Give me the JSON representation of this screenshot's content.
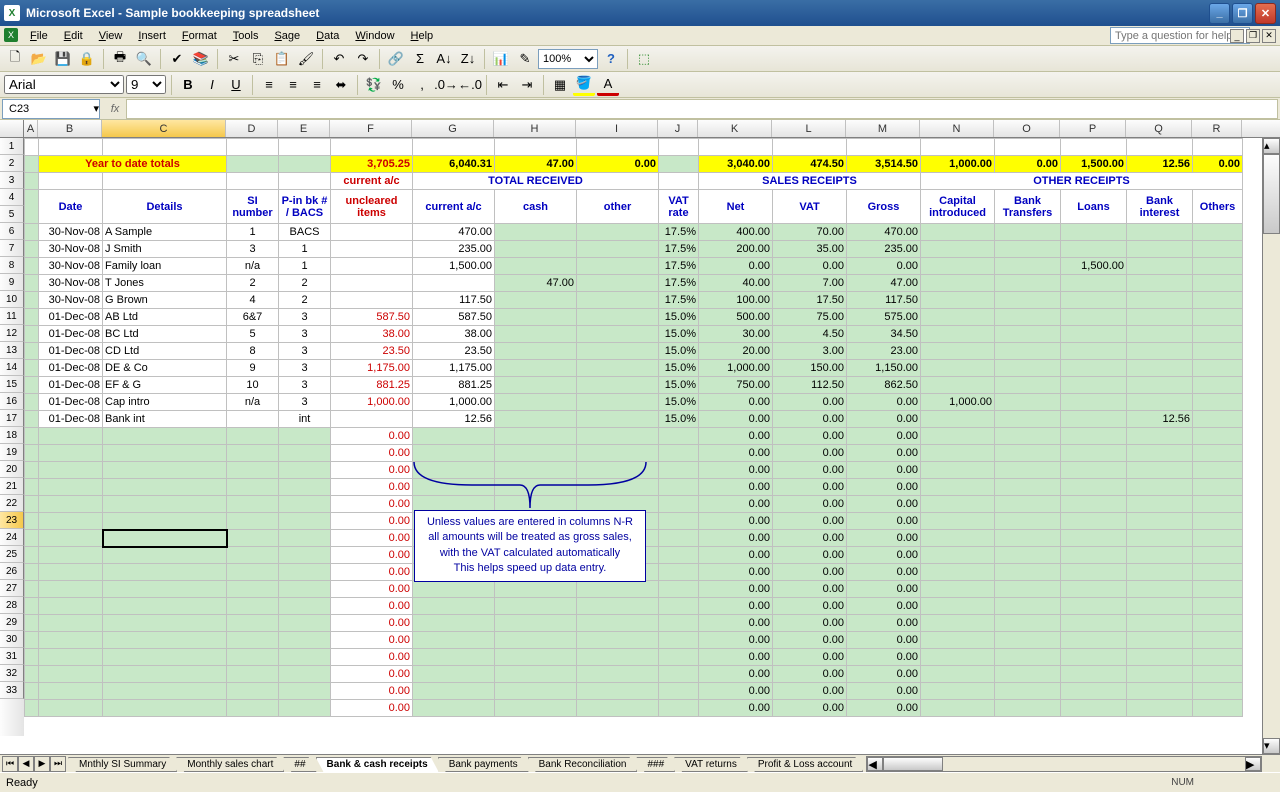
{
  "window": {
    "title": "Microsoft Excel - Sample bookkeeping spreadsheet"
  },
  "menus": [
    "File",
    "Edit",
    "View",
    "Insert",
    "Format",
    "Tools",
    "Sage",
    "Data",
    "Window",
    "Help"
  ],
  "helpPlaceholder": "Type a question for help",
  "nameBox": "C23",
  "font": {
    "name": "Arial",
    "size": "9"
  },
  "zoom": "100%",
  "columns": [
    {
      "l": "A",
      "w": 14
    },
    {
      "l": "B",
      "w": 64
    },
    {
      "l": "C",
      "w": 124
    },
    {
      "l": "D",
      "w": 52
    },
    {
      "l": "E",
      "w": 52
    },
    {
      "l": "F",
      "w": 82
    },
    {
      "l": "G",
      "w": 82
    },
    {
      "l": "H",
      "w": 82
    },
    {
      "l": "I",
      "w": 82
    },
    {
      "l": "J",
      "w": 40
    },
    {
      "l": "K",
      "w": 74
    },
    {
      "l": "L",
      "w": 74
    },
    {
      "l": "M",
      "w": 74
    },
    {
      "l": "N",
      "w": 74
    },
    {
      "l": "O",
      "w": 66
    },
    {
      "l": "P",
      "w": 66
    },
    {
      "l": "Q",
      "w": 66
    },
    {
      "l": "R",
      "w": 50
    }
  ],
  "row2": {
    "label": "Year to date totals",
    "vals": {
      "F": "3,705.25",
      "G": "6,040.31",
      "H": "47.00",
      "I": "0.00",
      "K": "3,040.00",
      "L": "474.50",
      "M": "3,514.50",
      "N": "1,000.00",
      "O": "0.00",
      "P": "1,500.00",
      "Q": "12.56",
      "R": "0.00"
    }
  },
  "headers3": {
    "F": "current a/c",
    "GHI": "TOTAL RECEIVED",
    "KLM": "SALES RECEIPTS",
    "NR": "OTHER RECEIPTS"
  },
  "headers4": {
    "B": "Date",
    "C": "Details",
    "D": "SI number",
    "E": "P-in bk # / BACS",
    "F": "uncleared items",
    "G": "current a/c",
    "H": "cash",
    "I": "other",
    "J": "VAT rate",
    "K": "Net",
    "L": "VAT",
    "M": "Gross",
    "N": "Capital introduced",
    "O": "Bank Transfers",
    "P": "Loans",
    "Q": "Bank interest",
    "R": "Others"
  },
  "rows": [
    {
      "r": 5,
      "B": "30-Nov-08",
      "C": "A Sample",
      "D": "1",
      "E": "BACS",
      "F": "",
      "G": "470.00",
      "H": "",
      "I": "",
      "J": "17.5%",
      "K": "400.00",
      "L": "70.00",
      "M": "470.00"
    },
    {
      "r": 6,
      "B": "30-Nov-08",
      "C": "J Smith",
      "D": "3",
      "E": "1",
      "F": "",
      "G": "235.00",
      "H": "",
      "I": "",
      "J": "17.5%",
      "K": "200.00",
      "L": "35.00",
      "M": "235.00"
    },
    {
      "r": 7,
      "B": "30-Nov-08",
      "C": "Family loan",
      "D": "n/a",
      "E": "1",
      "F": "",
      "G": "1,500.00",
      "H": "",
      "I": "",
      "J": "17.5%",
      "K": "0.00",
      "L": "0.00",
      "M": "0.00",
      "P": "1,500.00"
    },
    {
      "r": 8,
      "B": "30-Nov-08",
      "C": "T Jones",
      "D": "2",
      "E": "2",
      "F": "",
      "G": "",
      "H": "47.00",
      "I": "",
      "J": "17.5%",
      "K": "40.00",
      "L": "7.00",
      "M": "47.00"
    },
    {
      "r": 9,
      "B": "30-Nov-08",
      "C": "G Brown",
      "D": "4",
      "E": "2",
      "F": "",
      "G": "117.50",
      "H": "",
      "I": "",
      "J": "17.5%",
      "K": "100.00",
      "L": "17.50",
      "M": "117.50"
    },
    {
      "r": 10,
      "B": "01-Dec-08",
      "C": "AB Ltd",
      "D": "6&7",
      "E": "3",
      "F": "587.50",
      "G": "587.50",
      "H": "",
      "I": "",
      "J": "15.0%",
      "K": "500.00",
      "L": "75.00",
      "M": "575.00"
    },
    {
      "r": 11,
      "B": "01-Dec-08",
      "C": "BC Ltd",
      "D": "5",
      "E": "3",
      "F": "38.00",
      "G": "38.00",
      "H": "",
      "I": "",
      "J": "15.0%",
      "K": "30.00",
      "L": "4.50",
      "M": "34.50"
    },
    {
      "r": 12,
      "B": "01-Dec-08",
      "C": "CD Ltd",
      "D": "8",
      "E": "3",
      "F": "23.50",
      "G": "23.50",
      "H": "",
      "I": "",
      "J": "15.0%",
      "K": "20.00",
      "L": "3.00",
      "M": "23.00"
    },
    {
      "r": 13,
      "B": "01-Dec-08",
      "C": "DE & Co",
      "D": "9",
      "E": "3",
      "F": "1,175.00",
      "G": "1,175.00",
      "H": "",
      "I": "",
      "J": "15.0%",
      "K": "1,000.00",
      "L": "150.00",
      "M": "1,150.00"
    },
    {
      "r": 14,
      "B": "01-Dec-08",
      "C": "EF & G",
      "D": "10",
      "E": "3",
      "F": "881.25",
      "G": "881.25",
      "H": "",
      "I": "",
      "J": "15.0%",
      "K": "750.00",
      "L": "112.50",
      "M": "862.50"
    },
    {
      "r": 15,
      "B": "01-Dec-08",
      "C": "Cap intro",
      "D": "n/a",
      "E": "3",
      "F": "1,000.00",
      "G": "1,000.00",
      "H": "",
      "I": "",
      "J": "15.0%",
      "K": "0.00",
      "L": "0.00",
      "M": "0.00",
      "N": "1,000.00"
    },
    {
      "r": 16,
      "B": "01-Dec-08",
      "C": "Bank int",
      "D": "",
      "E": "int",
      "F": "",
      "G": "12.56",
      "H": "",
      "I": "",
      "J": "15.0%",
      "K": "0.00",
      "L": "0.00",
      "M": "0.00",
      "Q": "12.56"
    }
  ],
  "emptyRows": [
    17,
    18,
    19,
    20,
    21,
    22,
    23,
    24,
    25,
    26,
    27,
    28,
    29,
    30,
    31,
    32,
    33
  ],
  "callout": [
    "Unless values are entered in columns N-R",
    "all amounts will be treated as gross sales,",
    "with the VAT calculated automatically",
    "This helps speed up data entry."
  ],
  "tabs": [
    "Mnthly SI Summary",
    "Monthly sales chart",
    "##",
    "Bank & cash receipts",
    "Bank payments",
    "Bank Reconciliation",
    "###",
    "VAT returns",
    "Profit & Loss account"
  ],
  "activeTab": 3,
  "selectedCell": {
    "row": 23,
    "col": "C"
  },
  "status": "Ready",
  "numlock": "NUM"
}
